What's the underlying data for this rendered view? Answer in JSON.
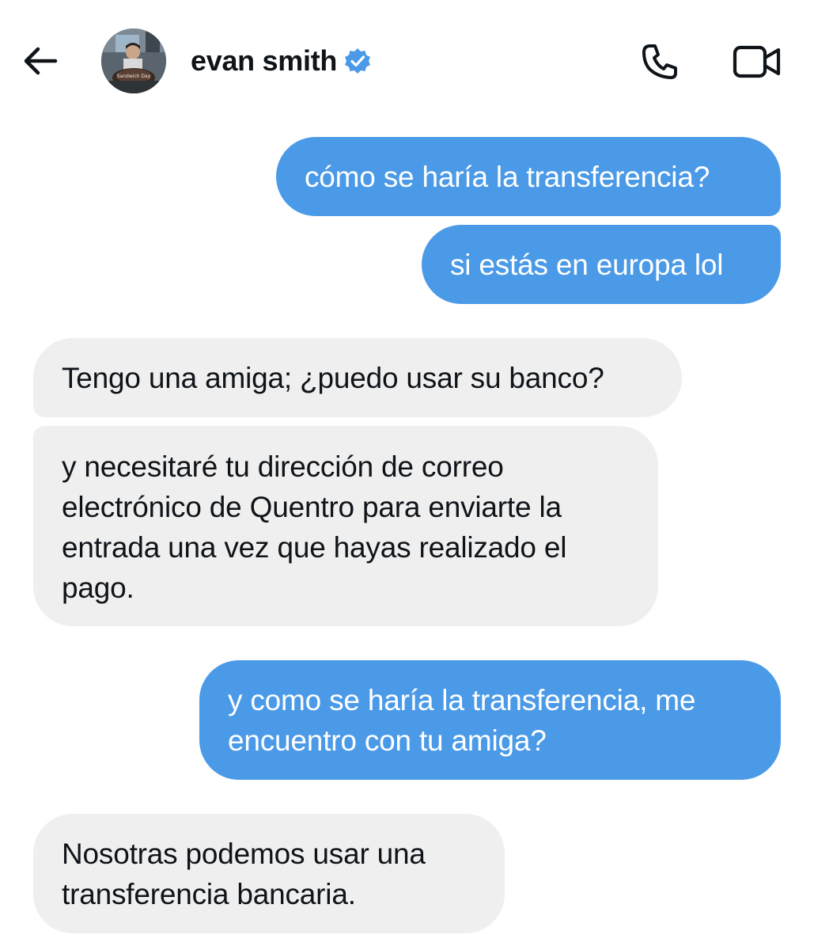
{
  "header": {
    "back_icon": "arrow-left-icon",
    "contact_name": "evan smith",
    "verified_icon": "verified-badge-icon",
    "call_icon": "phone-icon",
    "video_icon": "video-camera-icon",
    "avatar_caption": "Sandwich Day"
  },
  "colors": {
    "sent_bubble": "#4b9ae8",
    "received_bubble": "#efefef",
    "verified": "#4b9ae8",
    "text": "#0f1419"
  },
  "messages": [
    {
      "direction": "sent",
      "text": "cómo se haría la transferencia?"
    },
    {
      "direction": "sent",
      "text": "si estás en europa lol"
    },
    {
      "direction": "received",
      "text": "Tengo una amiga; ¿puedo usar su banco?"
    },
    {
      "direction": "received",
      "text": "y necesitaré tu dirección de correo electrónico de Quentro para enviarte la entrada una vez que hayas realizado el pago."
    },
    {
      "direction": "sent",
      "text": "y como se haría la transferencia, me encuentro con tu amiga?"
    },
    {
      "direction": "received",
      "text": "Nosotras podemos usar una transferencia bancaria."
    }
  ]
}
